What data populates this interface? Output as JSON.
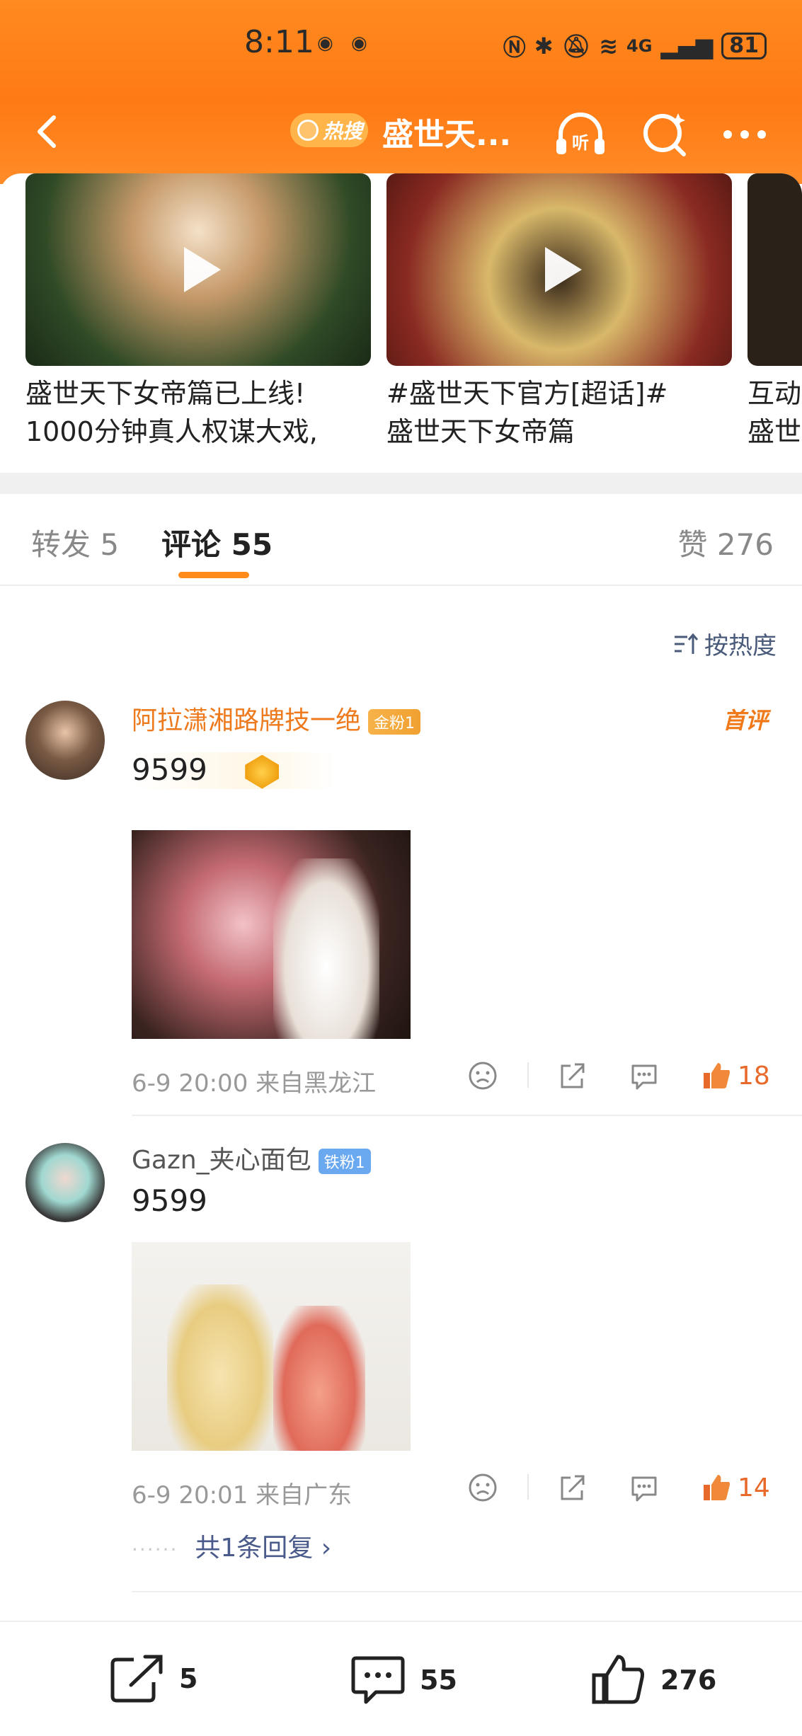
{
  "status_bar": {
    "time": "8:11",
    "network": "4G",
    "battery": "81"
  },
  "nav": {
    "hot_badge": "热搜",
    "title": "盛世天..."
  },
  "carousel": [
    {
      "line1": "盛世天下女帝篇已上线!",
      "line2": "1000分钟真人权谋大戏,"
    },
    {
      "line1": "#盛世天下官方[超话]#",
      "line2": "盛世天下女帝篇"
    },
    {
      "line1": "互动",
      "line2": "盛世"
    }
  ],
  "tabs": {
    "repost": "转发 5",
    "comments": "评论 55",
    "likes": "赞 276"
  },
  "sort_label": "按热度",
  "comments": [
    {
      "username": "阿拉潇湘路牌技一绝",
      "badge": "金粉1",
      "tag": "首评",
      "text": "9599",
      "meta": "6-9 20:00  来自黑龙江",
      "likes": "18"
    },
    {
      "username": "Gazn_夹心面包",
      "badge": "铁粉1",
      "text": "9599",
      "meta": "6-9 20:01  来自广东",
      "likes": "14",
      "replies": "共1条回复 ›"
    }
  ],
  "bottom_bar": {
    "reposts": "5",
    "comments": "55",
    "likes": "276"
  },
  "colors": {
    "header": "#ff7a14",
    "accent": "#ff8c1a",
    "like": "#e86a2a",
    "link": "#4a5a8a"
  }
}
